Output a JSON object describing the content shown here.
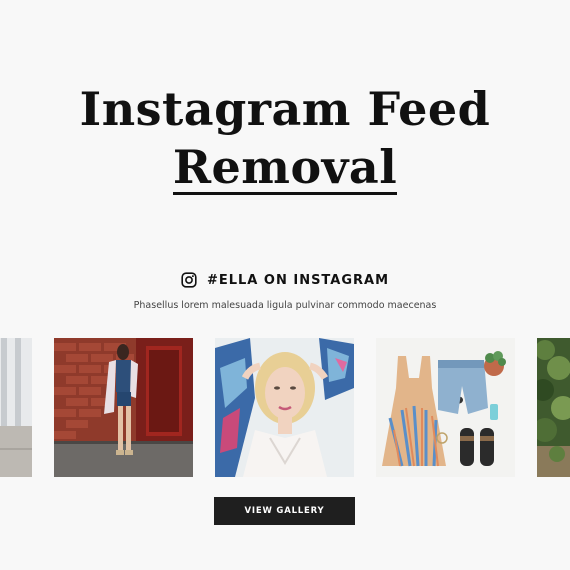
{
  "hero": {
    "title_line1": "Instagram Feed",
    "title_line2": "Removal"
  },
  "instagram": {
    "icon": "instagram-icon",
    "heading": "#ELLA ON INSTAGRAM",
    "subtitle": "Phasellus lorem malesuada ligula pulvinar commodo maecenas"
  },
  "feed": {
    "photos": [
      {
        "name": "photo-street-partial"
      },
      {
        "name": "photo-brick-wall-outfit"
      },
      {
        "name": "photo-blonde-portrait"
      },
      {
        "name": "photo-flatlay-dress"
      },
      {
        "name": "photo-greenery-partial"
      }
    ]
  },
  "actions": {
    "view_gallery_label": "VIEW GALLERY"
  },
  "colors": {
    "background": "#f8f8f8",
    "text": "#111111",
    "button": "#1f1f1f"
  }
}
